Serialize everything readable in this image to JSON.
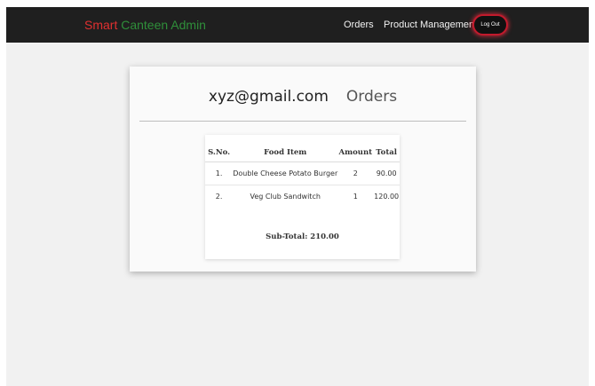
{
  "navbar": {
    "brand_part1": "Smart",
    "brand_part2": "Canteen Admin",
    "links": [
      {
        "label": "Orders"
      },
      {
        "label": "Product Management"
      }
    ],
    "logout_label": "Log Out"
  },
  "card": {
    "email": "xyz@gmail.com",
    "title": "Orders"
  },
  "orders_table": {
    "headers": [
      "S.No.",
      "Food Item",
      "Amount",
      "Total"
    ],
    "rows": [
      [
        "1.",
        "Double Cheese Potato Burger",
        "2",
        "90.00"
      ],
      [
        "2.",
        "Veg Club Sandwitch",
        "1",
        "120.00"
      ]
    ],
    "subtotal": "Sub-Total: 210.00"
  },
  "colors": {
    "navbar_bg": "#1f1f1f",
    "brand_red": "#e03030",
    "brand_green": "#2f8f3a",
    "logout_glow": "#c21a2c"
  }
}
